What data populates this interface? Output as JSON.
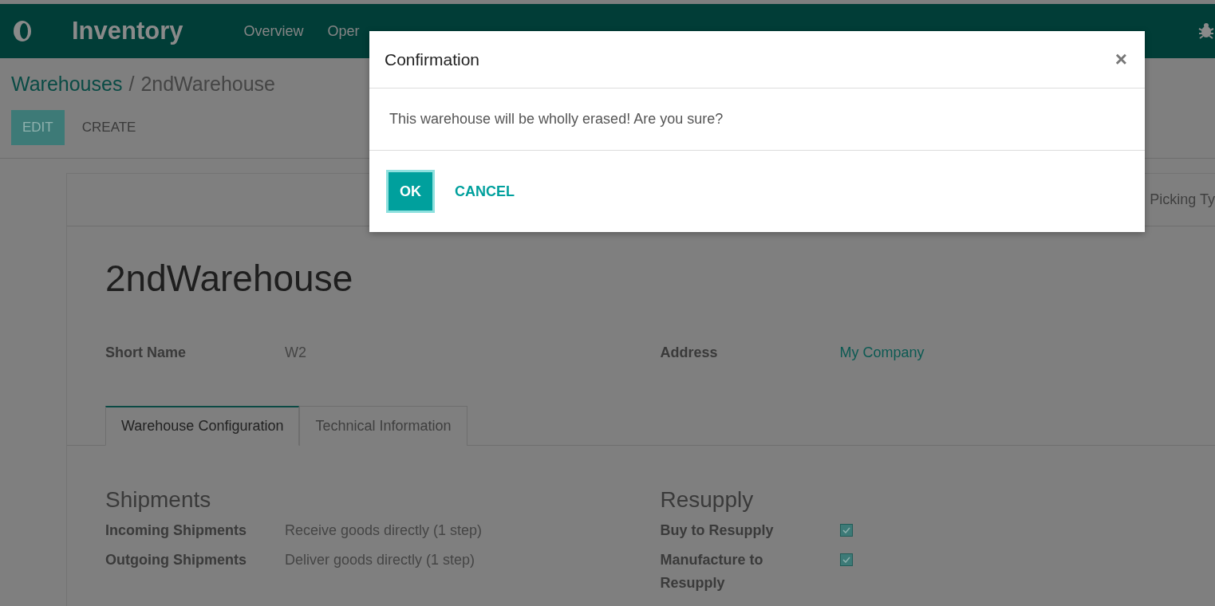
{
  "navbar": {
    "app_title": "Inventory",
    "menu": [
      {
        "label": "Overview"
      },
      {
        "label": "Oper"
      }
    ]
  },
  "breadcrumb": {
    "parent": "Warehouses",
    "separator": "/",
    "current": "2ndWarehouse"
  },
  "actions": [
    {
      "label": "EDIT",
      "kind": "primary"
    },
    {
      "label": "CREATE",
      "kind": "secondary"
    }
  ],
  "sheet": {
    "header_button": "Picking Ty",
    "title": "2ndWarehouse",
    "fields": [
      {
        "label": "Short Name",
        "value": "W2",
        "kind": "text"
      },
      {
        "label": "Address",
        "value": "My Company",
        "kind": "link"
      }
    ],
    "tabs": [
      {
        "label": "Warehouse Configuration",
        "selected": true
      },
      {
        "label": "Technical Information",
        "selected": false
      }
    ],
    "sections": [
      {
        "title": "Shipments",
        "rows": [
          {
            "kind": "text",
            "label": "Incoming Shipments",
            "value": "Receive goods directly (1 step)"
          },
          {
            "kind": "text",
            "label": "Outgoing Shipments",
            "value": "Deliver goods directly (1 step)"
          }
        ]
      },
      {
        "title": "Resupply",
        "rows": [
          {
            "kind": "checkbox",
            "label": "Buy to Resupply",
            "checked": true
          },
          {
            "kind": "checkbox",
            "label": "Manufacture to Resupply",
            "checked": true
          }
        ]
      }
    ]
  },
  "dialog": {
    "title": "Confirmation",
    "close": "×",
    "message": "This warehouse will be wholly erased! Are you sure?",
    "buttons": [
      {
        "label": "OK",
        "kind": "primary",
        "focused": true
      },
      {
        "label": "CANCEL",
        "kind": "link",
        "focused": false
      }
    ]
  }
}
